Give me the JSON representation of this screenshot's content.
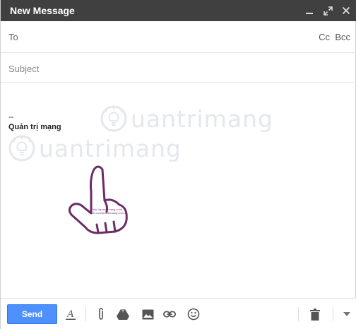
{
  "window": {
    "title": "New Message",
    "controls": [
      "minimize-icon",
      "expand-icon",
      "close-icon"
    ]
  },
  "recipients": {
    "to_label": "To",
    "cc_label": "Cc",
    "bcc_label": "Bcc"
  },
  "subject": {
    "placeholder": "Subject",
    "value": ""
  },
  "body": {
    "signature_dash": "--",
    "signature_name": "Quản trị mạng",
    "hand_caption_line1": "http://quantrimang.com/",
    "hand_caption_line2": "fb.com/quantrimang.com.vn"
  },
  "toolbar": {
    "send_label": "Send",
    "icons": [
      "formatting-icon",
      "attach-icon",
      "drive-icon",
      "photo-icon",
      "link-icon",
      "emoji-icon",
      "trash-icon",
      "more-options-icon"
    ]
  },
  "colors": {
    "titlebar": "#404040",
    "send_button": "#4d90fe",
    "hand_outline": "#6b2c68"
  }
}
